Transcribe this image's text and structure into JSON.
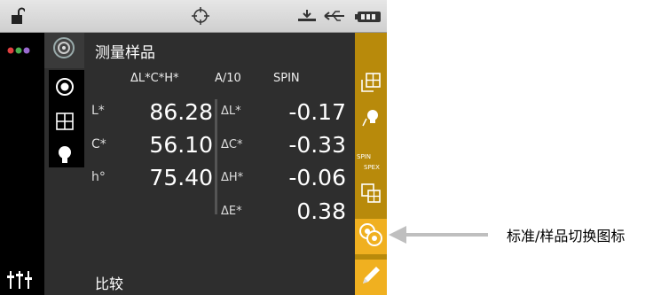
{
  "screen": {
    "title": "测量样品",
    "footer": "比较",
    "header": {
      "color_space": "ΔL*C*H*",
      "illuminant": "A/10",
      "mode": "SPIN"
    },
    "rows": [
      {
        "label": "L*",
        "value": "86.28",
        "delta_label": "ΔL*",
        "delta_value": "-0.17"
      },
      {
        "label": "C*",
        "value": "56.10",
        "delta_label": "ΔC*",
        "delta_value": "-0.33"
      },
      {
        "label": "h°",
        "value": "75.40",
        "delta_label": "ΔH*",
        "delta_value": "-0.06"
      }
    ],
    "delta_e": {
      "label": "ΔE*",
      "value": "0.38"
    }
  },
  "buttons": {
    "spin_label": "SPIN",
    "spex_label": "SPEX"
  },
  "callout": {
    "text": "标准/样品切换图标"
  },
  "icons": {
    "status": [
      "unlock-icon",
      "target-icon",
      "tray-icon",
      "usb-icon",
      "battery-icon"
    ],
    "left": [
      "color-dots-icon",
      "sliders-icon"
    ],
    "tabs": [
      "target-tab-icon",
      "sample-target-icon",
      "grid-icon",
      "bulb-icon"
    ],
    "right": [
      "copy-grid-icon",
      "bulb-button-icon",
      "spin-spex-icon",
      "grid-layout-icon",
      "standard-sample-toggle-icon",
      "pencil-icon"
    ]
  },
  "colors": {
    "accent": "#f0b020",
    "button_column": "#b88a0b",
    "panel": "#2e2e2e",
    "callout_arrow": "#bfbfbf"
  }
}
